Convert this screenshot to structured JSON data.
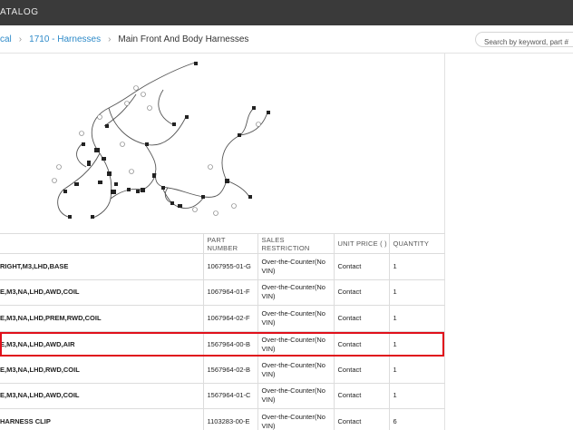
{
  "header": {
    "title": "ATALOG"
  },
  "breadcrumb": {
    "items": [
      {
        "label": "cal",
        "link": true
      },
      {
        "label": "1710 - Harnesses",
        "link": true
      },
      {
        "label": "Main Front And Body Harnesses",
        "link": false
      }
    ],
    "separator": "›"
  },
  "search": {
    "placeholder": "Search by keyword, part #"
  },
  "table": {
    "headers": [
      "",
      "PART NUMBER",
      "SALES RESTRICTION",
      "UNIT PRICE ( )",
      "QUANTITY"
    ],
    "rows": [
      {
        "name": "RIGHT,M3,LHD,BASE",
        "part": "1067955-01-G",
        "restriction": "Over-the-Counter(No VIN)",
        "price": "Contact",
        "qty": "1"
      },
      {
        "name": "E,M3,NA,LHD,AWD,COIL",
        "part": "1067964-01-F",
        "restriction": "Over-the-Counter(No VIN)",
        "price": "Contact",
        "qty": "1"
      },
      {
        "name": "E,M3,NA,LHD,PREM,RWD,COIL",
        "part": "1067964-02-F",
        "restriction": "Over-the-Counter(No VIN)",
        "price": "Contact",
        "qty": "1"
      },
      {
        "name": "E,M3,NA,LHD,AWD,AIR",
        "part": "1567964-00-B",
        "restriction": "Over-the-Counter(No VIN)",
        "price": "Contact",
        "qty": "1",
        "highlighted": true
      },
      {
        "name": "E,M3,NA,LHD,RWD,COIL",
        "part": "1567964-02-B",
        "restriction": "Over-the-Counter(No VIN)",
        "price": "Contact",
        "qty": "1"
      },
      {
        "name": "E,M3,NA,LHD,AWD,COIL",
        "part": "1567964-01-C",
        "restriction": "Over-the-Counter(No VIN)",
        "price": "Contact",
        "qty": "1"
      },
      {
        "name": "HARNESS CLIP",
        "part": "1103283-00-E",
        "restriction": "Over-the-Counter(No VIN)",
        "price": "Contact",
        "qty": "6"
      }
    ]
  },
  "colors": {
    "topbar": "#3a3a3a",
    "link": "#2f8bc9",
    "highlight": "#e0101b"
  }
}
